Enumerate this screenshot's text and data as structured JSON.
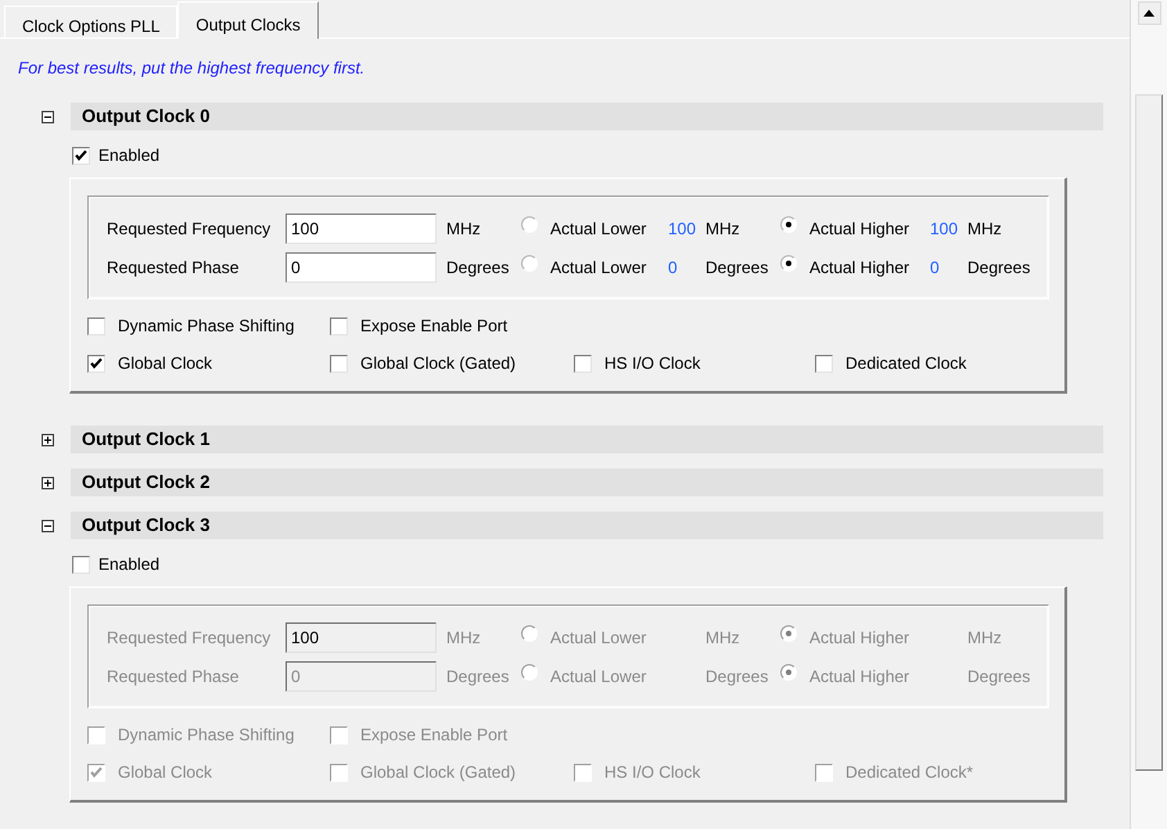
{
  "tabs": [
    {
      "label": "Clock Options PLL",
      "selected": false
    },
    {
      "label": "Output Clocks",
      "selected": true
    }
  ],
  "hint": "For best results, put the highest frequency first.",
  "sections": [
    {
      "title": "Output Clock 0",
      "expanded": true,
      "enabled": {
        "label": "Enabled",
        "checked": true
      },
      "rows": [
        {
          "label": "Requested Frequency",
          "value": "100",
          "unit": "MHz",
          "lower_label": "Actual Lower",
          "lower_value": "100",
          "lower_unit": "MHz",
          "lower_selected": false,
          "higher_label": "Actual Higher",
          "higher_value": "100",
          "higher_unit": "MHz",
          "higher_selected": true
        },
        {
          "label": "Requested Phase",
          "value": "0",
          "unit": "Degrees",
          "lower_label": "Actual Lower",
          "lower_value": "0",
          "lower_unit": "Degrees",
          "lower_selected": false,
          "higher_label": "Actual Higher",
          "higher_value": "0",
          "higher_unit": "Degrees",
          "higher_selected": true
        }
      ],
      "options": [
        {
          "label": "Dynamic Phase Shifting",
          "checked": false
        },
        {
          "label": "Expose Enable Port",
          "checked": false
        },
        {
          "label": "Global Clock",
          "checked": true
        },
        {
          "label": "Global Clock (Gated)",
          "checked": false
        },
        {
          "label": "HS I/O Clock",
          "checked": false
        },
        {
          "label": "Dedicated Clock",
          "checked": false
        }
      ]
    },
    {
      "title": "Output Clock 1",
      "expanded": false
    },
    {
      "title": "Output Clock 2",
      "expanded": false
    },
    {
      "title": "Output Clock 3",
      "expanded": true,
      "enabled": {
        "label": "Enabled",
        "checked": false
      },
      "rows": [
        {
          "label": "Requested Frequency",
          "value": "100",
          "unit": "MHz",
          "lower_label": "Actual Lower",
          "lower_unit": "MHz",
          "lower_selected": false,
          "higher_label": "Actual Higher",
          "higher_unit": "MHz",
          "higher_selected": true
        },
        {
          "label": "Requested Phase",
          "value": "0",
          "unit": "Degrees",
          "lower_label": "Actual Lower",
          "lower_unit": "Degrees",
          "lower_selected": false,
          "higher_label": "Actual Higher",
          "higher_unit": "Degrees",
          "higher_selected": true
        }
      ],
      "options": [
        {
          "label": "Dynamic Phase Shifting",
          "checked": false
        },
        {
          "label": "Expose Enable Port",
          "checked": false
        },
        {
          "label": "Global Clock",
          "checked": true
        },
        {
          "label": "Global Clock (Gated)",
          "checked": false
        },
        {
          "label": "HS I/O Clock",
          "checked": false
        },
        {
          "label": "Dedicated Clock*",
          "checked": false
        }
      ]
    }
  ]
}
